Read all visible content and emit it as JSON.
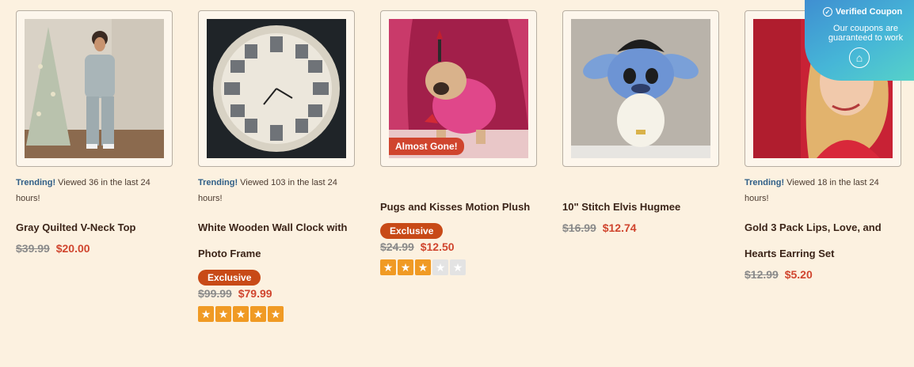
{
  "products": [
    {
      "trending_key": "Trending!",
      "trending_text": "Viewed 36 in the last 24 hours!",
      "title": "Gray Quilted V-Neck Top",
      "old_price": "$39.99",
      "new_price": "$20.00"
    },
    {
      "trending_key": "Trending!",
      "trending_text": "Viewed 103 in the last 24 hours!",
      "title": "White Wooden Wall Clock with Photo Frame",
      "exclusive": "Exclusive",
      "old_price": "$99.99",
      "new_price": "$79.99",
      "rating": 5
    },
    {
      "badge": "Almost Gone!",
      "title": "Pugs and Kisses Motion Plush",
      "exclusive": "Exclusive",
      "old_price": "$24.99",
      "new_price": "$12.50",
      "rating": 3
    },
    {
      "title": "10\" Stitch Elvis Hugmee",
      "old_price": "$16.99",
      "new_price": "$12.74"
    },
    {
      "trending_key": "Trending!",
      "trending_text": "Viewed 18 in the last 24 hours!",
      "title": "Gold 3 Pack Lips, Love, and Hearts Earring Set",
      "old_price": "$12.99",
      "new_price": "$5.20"
    }
  ],
  "star_glyph": "★",
  "coupon": {
    "title": "Verified Coupon",
    "text": "Our coupons are guaranteed to work",
    "check_glyph": "✓",
    "icon_glyph": "⌂"
  }
}
